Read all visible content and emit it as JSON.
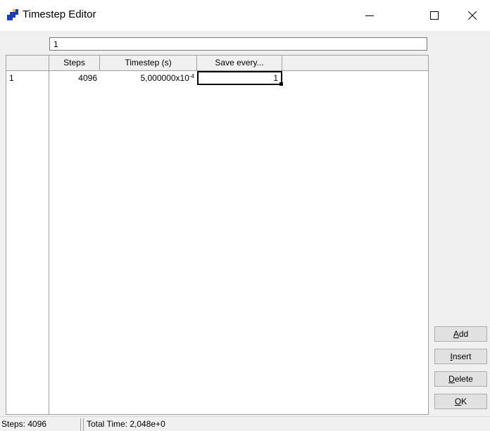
{
  "window": {
    "title": "Timestep Editor",
    "controls": {
      "minimize": "minimize",
      "maximize": "maximize",
      "close": "close"
    }
  },
  "cell_editor": {
    "value": "1"
  },
  "table": {
    "columns": [
      "Steps",
      "Timestep (s)",
      "Save every..."
    ],
    "rows": [
      {
        "row_label": "1",
        "steps": "4096",
        "timestep_mantissa": "5,000000x10",
        "timestep_exponent": "-4",
        "save_every": "1"
      }
    ]
  },
  "buttons": {
    "add": "Add",
    "insert": "Insert",
    "delete": "Delete",
    "ok": "OK"
  },
  "status": {
    "steps": "Steps: 4096",
    "total_time": "Total Time: 2,048e+0"
  },
  "colors": {
    "icon_blue": "#1a3fb5",
    "icon_yellow": "#f2c200",
    "window_bg": "#f0f0f0"
  }
}
